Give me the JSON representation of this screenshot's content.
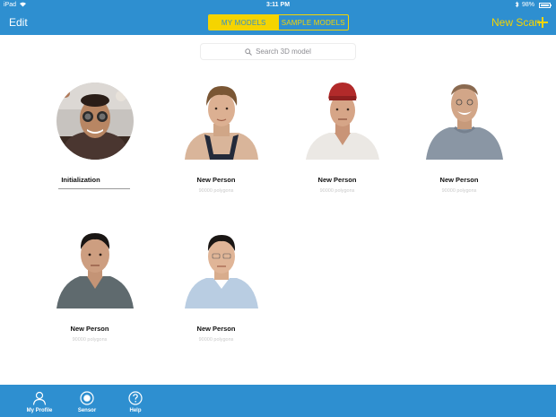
{
  "status_bar": {
    "carrier": "iPad",
    "time": "3:11 PM",
    "battery": "98%"
  },
  "nav": {
    "edit": "Edit",
    "segments": [
      "MY MODELS",
      "SAMPLE MODELS"
    ],
    "new_scan": "New Scan"
  },
  "search": {
    "placeholder": "Search 3D model"
  },
  "models": [
    {
      "name": "Initialization",
      "sub": ""
    },
    {
      "name": "New Person",
      "sub": "90000 polygons"
    },
    {
      "name": "New Person",
      "sub": "90000 polygons"
    },
    {
      "name": "New Person",
      "sub": "90000 polygons"
    },
    {
      "name": "New Person",
      "sub": "90000 polygons"
    },
    {
      "name": "New Person",
      "sub": "90000 polygons"
    }
  ],
  "tabs": [
    "My Profile",
    "Sensor",
    "Help"
  ],
  "colors": {
    "nav_blue": "#2e8fd0",
    "accent_yellow": "#f5d400"
  }
}
